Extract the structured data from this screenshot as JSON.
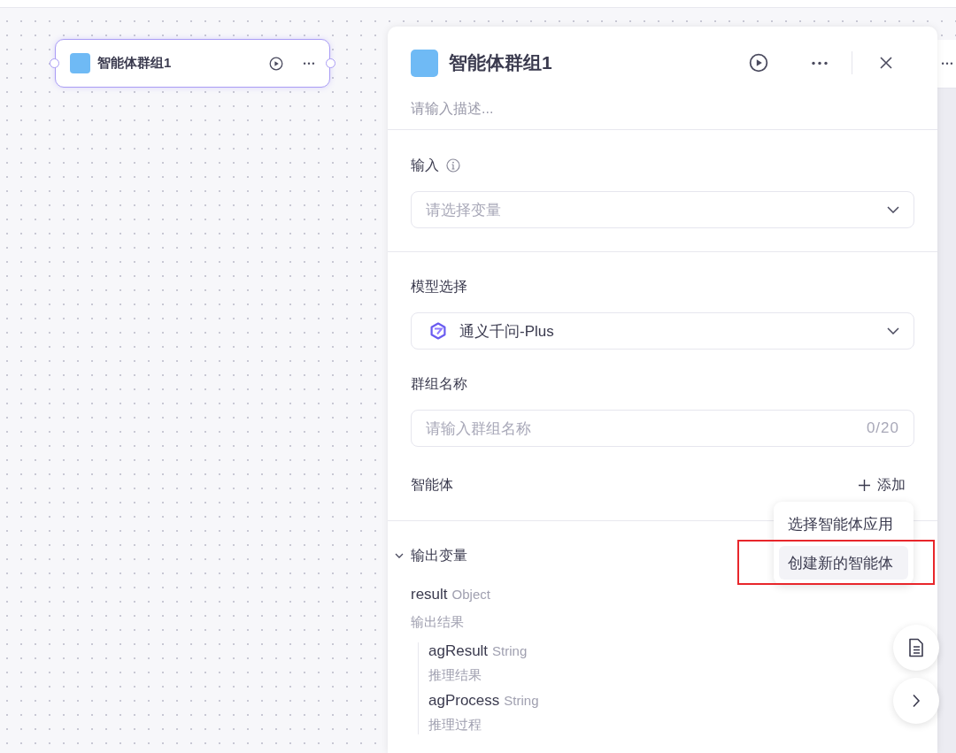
{
  "canvas_node": {
    "title": "智能体群组1"
  },
  "panel": {
    "title": "智能体群组1",
    "description_placeholder": "请输入描述..."
  },
  "input_section": {
    "label": "输入",
    "placeholder": "请选择变量"
  },
  "model_section": {
    "label": "模型选择",
    "value": "通义千问-Plus"
  },
  "group_name": {
    "label": "群组名称",
    "placeholder": "请输入群组名称",
    "counter": "0/20"
  },
  "agents": {
    "label": "智能体",
    "add_label": "添加",
    "menu": [
      {
        "label": "选择智能体应用",
        "selected": false
      },
      {
        "label": "创建新的智能体",
        "selected": true
      }
    ]
  },
  "output": {
    "label": "输出变量",
    "expanded": true,
    "variables": [
      {
        "name": "result",
        "type": "Object",
        "description": "输出结果",
        "children": [
          {
            "name": "agResult",
            "type": "String",
            "description": "推理结果"
          },
          {
            "name": "agProcess",
            "type": "String",
            "description": "推理过程"
          }
        ]
      }
    ]
  }
}
